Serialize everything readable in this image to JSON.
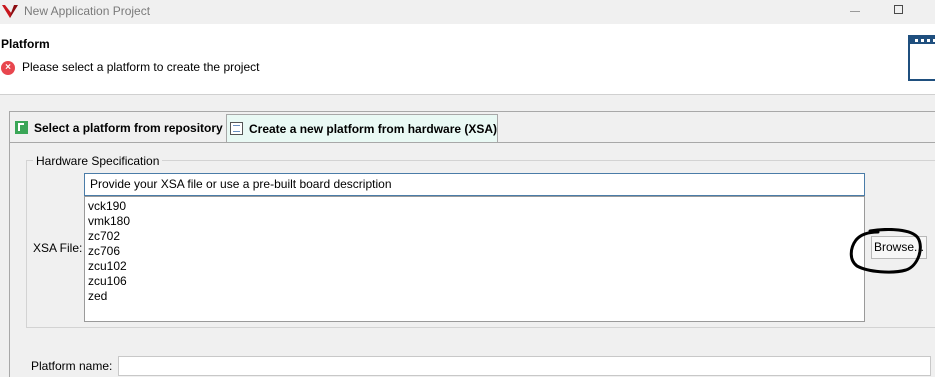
{
  "window": {
    "title": "New Application Project"
  },
  "header": {
    "title": "Platform",
    "error_message": "Please select a platform to create the project"
  },
  "tabs": [
    {
      "label": "Select a platform from repository",
      "active": false
    },
    {
      "label": "Create a new platform from hardware (XSA)",
      "active": true
    }
  ],
  "hardware_spec": {
    "group_label": "Hardware Specification",
    "xsa_input_value": "Provide your XSA file or use a pre-built board description",
    "xsa_label": "XSA File:",
    "boards": [
      "vck190",
      "vmk180",
      "zc702",
      "zc706",
      "zcu102",
      "zcu106",
      "zed"
    ],
    "browse_label": "Browse..."
  },
  "platform_name": {
    "label": "Platform name:",
    "value": ""
  },
  "colors": {
    "error": "#e8464e",
    "active_tab_bg": "#e9f9f4",
    "input_focus_border": "#4a7ca8",
    "annotation": "#000000"
  },
  "icons": {
    "app": "vitis-logo-icon",
    "error": "error-icon",
    "repo_tab": "repository-icon",
    "hw_tab": "hardware-platform-icon",
    "wizard": "wizard-banner-icon"
  }
}
